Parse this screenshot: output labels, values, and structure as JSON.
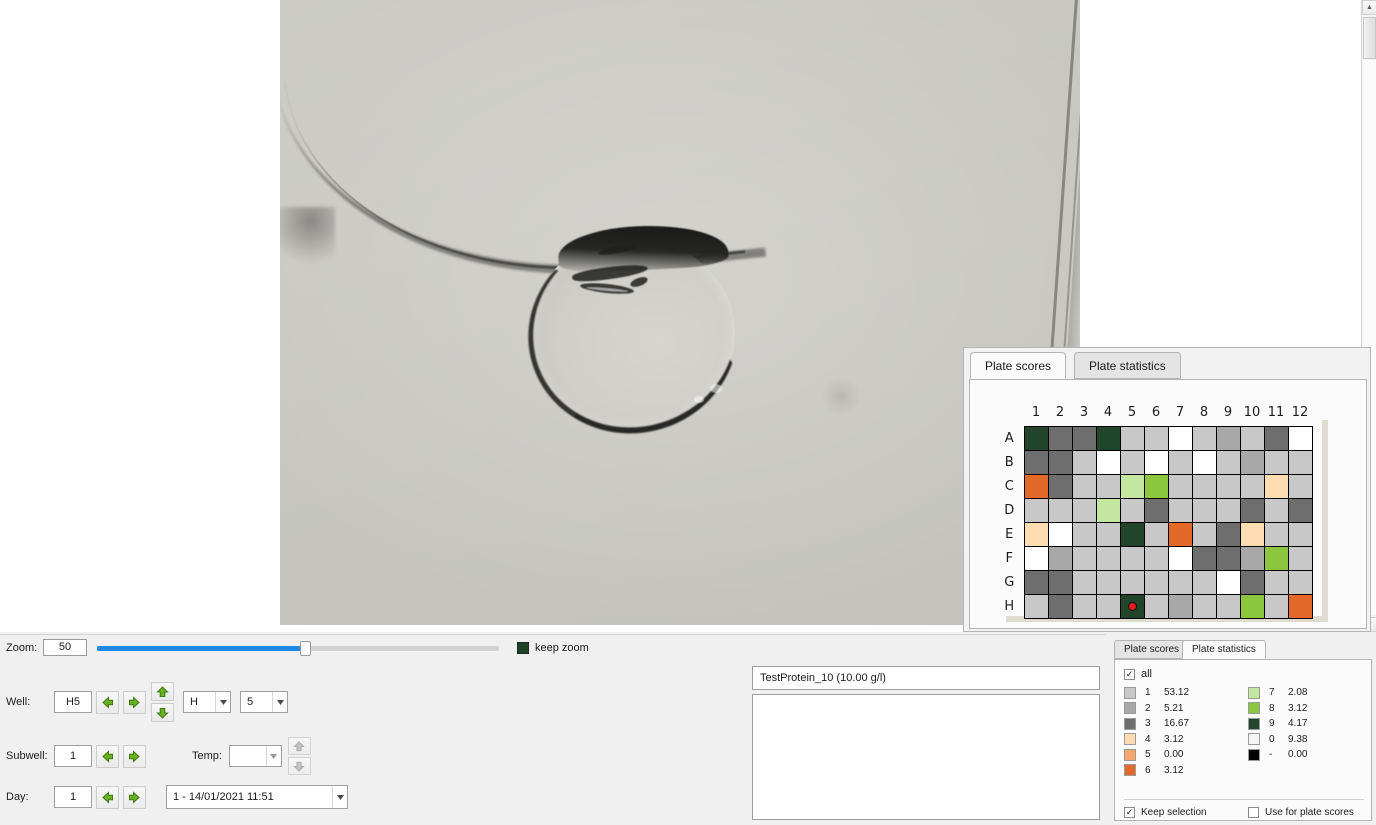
{
  "viewer": {
    "scrollbar": {
      "up_glyph": "▲",
      "down_glyph": "▼"
    }
  },
  "zoom_bar": {
    "label": "Zoom:",
    "value": "50",
    "slider_percent": 50,
    "keep_zoom_label": "keep zoom",
    "keep_zoom_checked": true
  },
  "controls": {
    "well": {
      "label": "Well:",
      "value": "H5",
      "prev_label": "◀",
      "next_label": "▶",
      "up_label": "▲",
      "down_label": "▼",
      "row_select": "H",
      "col_select": "5"
    },
    "subwell": {
      "label": "Subwell:",
      "value": "1",
      "prev_label": "◀",
      "next_label": "▶"
    },
    "temp": {
      "label": "Temp:",
      "value": "",
      "up_label": "▲",
      "down_label": "▼"
    },
    "day": {
      "label": "Day:",
      "value": "1",
      "prev_label": "◀",
      "next_label": "▶",
      "date_select": "1 - 14/01/2021 11:51"
    }
  },
  "text_panel": {
    "protein": "TestProtein_10 (10.00 g/l)",
    "notes": ""
  },
  "plate_panel": {
    "tabs": [
      {
        "label": "Plate scores",
        "active": true
      },
      {
        "label": "Plate statistics",
        "active": false
      }
    ],
    "columns": [
      "1",
      "2",
      "3",
      "4",
      "5",
      "6",
      "7",
      "8",
      "9",
      "10",
      "11",
      "12"
    ],
    "rows": [
      "A",
      "B",
      "C",
      "D",
      "E",
      "F",
      "G",
      "H"
    ],
    "selected_well": {
      "row": "H",
      "col": "5"
    },
    "score_colors": {
      "1": "#c8c8c8",
      "2": "#a8a8a8",
      "3": "#6e6e6e",
      "4": "#fcdcb0",
      "5": "#f5a66a",
      "6": "#e2692a",
      "7": "#c3e6a0",
      "8": "#8cc63f",
      "9": "#20452a",
      "0": "#ffffff",
      "-": "#000000"
    },
    "grid_scores": [
      [
        "9",
        "3",
        "3",
        "9",
        "1",
        "1",
        "0",
        "1",
        "2",
        "1",
        "3",
        "0"
      ],
      [
        "3",
        "3",
        "1",
        "0",
        "1",
        "0",
        "1",
        "0",
        "1",
        "2",
        "1",
        "1"
      ],
      [
        "6",
        "3",
        "1",
        "1",
        "7",
        "8",
        "1",
        "1",
        "1",
        "1",
        "4",
        "1"
      ],
      [
        "1",
        "1",
        "1",
        "7",
        "1",
        "3",
        "1",
        "1",
        "1",
        "3",
        "1",
        "3"
      ],
      [
        "4",
        "0",
        "1",
        "1",
        "9",
        "1",
        "6",
        "1",
        "3",
        "4",
        "1",
        "1"
      ],
      [
        "0",
        "2",
        "1",
        "1",
        "1",
        "1",
        "0",
        "3",
        "3",
        "2",
        "8",
        "1"
      ],
      [
        "3",
        "3",
        "1",
        "1",
        "1",
        "1",
        "1",
        "1",
        "0",
        "3",
        "1",
        "1"
      ],
      [
        "1",
        "3",
        "1",
        "1",
        "9",
        "1",
        "2",
        "1",
        "1",
        "8",
        "1",
        "6"
      ]
    ]
  },
  "stats_panel": {
    "tabs": [
      {
        "label": "Plate scores",
        "active": false
      },
      {
        "label": "Plate statistics",
        "active": true
      }
    ],
    "all_label": "all",
    "all_checked": true,
    "left_entries": [
      {
        "color": "#c8c8c8",
        "key": "1",
        "value": "53.12"
      },
      {
        "color": "#a8a8a8",
        "key": "2",
        "value": "5.21"
      },
      {
        "color": "#6e6e6e",
        "key": "3",
        "value": "16.67"
      },
      {
        "color": "#fcdcb0",
        "key": "4",
        "value": "3.12"
      },
      {
        "color": "#f5a66a",
        "key": "5",
        "value": "0.00"
      },
      {
        "color": "#e2692a",
        "key": "6",
        "value": "3.12"
      }
    ],
    "right_entries": [
      {
        "color": "#c3e6a0",
        "key": "7",
        "value": "2.08"
      },
      {
        "color": "#8cc63f",
        "key": "8",
        "value": "3.12"
      },
      {
        "color": "#20452a",
        "key": "9",
        "value": "4.17"
      },
      {
        "color": "#f5f5f5",
        "key": "0",
        "value": "9.38"
      },
      {
        "color": "#000000",
        "key": "-",
        "value": "0.00"
      }
    ],
    "keep_selection_label": "Keep selection",
    "keep_selection_checked": true,
    "use_for_plate_scores_label": "Use for plate scores",
    "use_for_plate_scores_checked": false,
    "check_glyph": "✓"
  }
}
